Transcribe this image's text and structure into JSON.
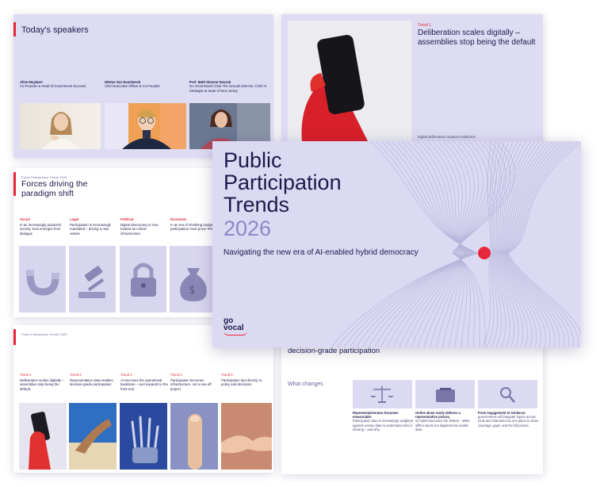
{
  "speakers_slide": {
    "title": "Today's speakers",
    "speakers": [
      {
        "name": "Aline Muylaert",
        "role": "Co-Founder & Head of Government Success"
      },
      {
        "name": "Wietse Van Ransbeeck",
        "role": "Chief Executive Officer & Co-Founder"
      },
      {
        "name": "Prof. Beth Simone Noveck",
        "role": "Go Vocal Board Chair\nThe GovLab Director, Chief AI Strategist at State of New Jersey"
      }
    ]
  },
  "forces_slide": {
    "kicker": "Public Participation Trends 2026",
    "title": "Forces driving the paradigm shift",
    "forces": [
      {
        "label": "Social",
        "text": "In an increasingly polarized society, trust emerges from dialogue",
        "icon": "magnet-icon"
      },
      {
        "label": "Legal",
        "text": "Participation is increasingly mandated – driving a new culture",
        "icon": "gavel-icon"
      },
      {
        "label": "Political",
        "text": "Digital democracy is now treated as critical infrastructure",
        "icon": "lock-icon"
      },
      {
        "label": "Economic",
        "text": "In an era of shrinking budgets, participation must prove ROI",
        "icon": "money-bag-icon"
      }
    ]
  },
  "trends_slide": {
    "kicker": "Public Participation Trends 2026",
    "trends": [
      {
        "label": "Trend 1",
        "text": "Deliberation scales digitally – assemblies stop being the default"
      },
      {
        "label": "Trend 2",
        "text": "Representative data enables decision-grade participation"
      },
      {
        "label": "Trend 3",
        "text": "AI becomes the operational backbone – and expands to the front end"
      },
      {
        "label": "Trend 4",
        "text": "Participation becomes infrastructure, not a one-off project"
      },
      {
        "label": "Trend 5",
        "text": "Participation tied directly to policy and decisions"
      }
    ]
  },
  "trend1_slide": {
    "label": "Trend 1",
    "title": "Deliberation scales digitally – assemblies stop being the default",
    "subtext": "Digital deliberation replaces traditional"
  },
  "changes_slide": {
    "header": "decision-grade participation",
    "what_changes": "What changes",
    "cards": [
      {
        "icon": "scales-icon",
        "bold": "Representativeness becomes measurable:",
        "text": "Participation data is increasingly weighted against census data to understand who is missing – and why."
      },
      {
        "icon": "ballot-box-icon",
        "bold": "Online alone rarely delivers a representative picture,",
        "text": "so hybrid becomes the default – while offline inputs are digitized into usable data."
      },
      {
        "icon": "magnifier-icon",
        "bold": "From engagement to evidence:",
        "text": "governments will integrate inputs across tools and channels into one place to show coverage, gaps, and the full picture."
      }
    ]
  },
  "hero": {
    "title_line1": "Public",
    "title_line2": "Participation",
    "title_line3": "Trends",
    "year": "2026",
    "subtitle": "Navigating the new era of AI-enabled hybrid democracy",
    "logo_line1": "go",
    "logo_line2": "vocal"
  },
  "colors": {
    "accent": "#e8283a",
    "ink": "#1b1a4a",
    "lavender": "#dcdaf2",
    "year": "#8b88c9"
  }
}
